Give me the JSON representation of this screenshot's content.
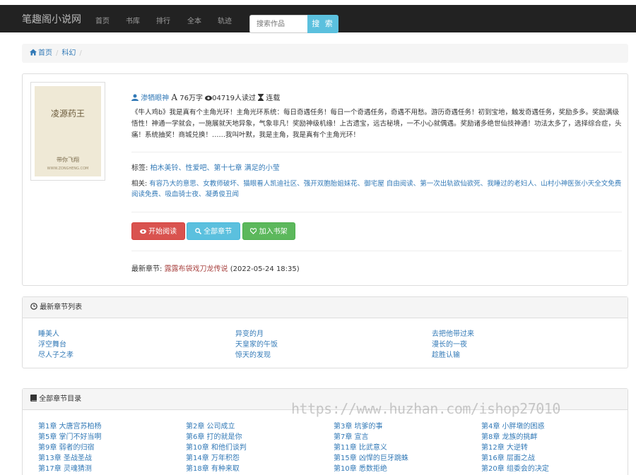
{
  "navbar": {
    "brand": "笔趣阁小说网",
    "items": [
      "首页",
      "书库",
      "排行",
      "全本",
      "轨迹"
    ],
    "search_placeholder": "搜索作品",
    "search_button": "搜 索"
  },
  "breadcrumb": {
    "home": "首页",
    "category": "科幻",
    "separator": "/"
  },
  "book": {
    "cover_title": "凌源药王",
    "cover_author": "带你飞翔",
    "cover_url": "WWW.ZONGHENG.COM",
    "author": "渗牺眼神",
    "word_count": "76万字",
    "readers": "04719人读过",
    "status": "连载",
    "description": "《牛人鸡b》我是真有个主角光环！主角光环系统：每日奇遇任务！每日一个奇遇任务，奇遇不用愁。游历奇遇任务！初到宝地，触发奇遇任务，奖励多多。奖励满级悟性！神通一学就会，一施展就天地异象，气象非凡！奖励神级机缘！上古遗宝，远古秘境，一不小心就偶遇。奖励诸多绝世仙技神通！功法太多了，选择综合症，头痛！系统抽奖！商城兑换！……我叫叶默，我是主角，我是真有个主角光环！",
    "tags_label": "标签:",
    "tags": "柏木美铃、性爱吧、第十七章 满足的小莹",
    "related_label": "相关:",
    "related": "有容乃大的意思、女教师破坏、猫眼看人凯迪社区、强开双胞胎姐妹花、御宅屋 自由阅读、第一次出轨欲仙欲死、我睡过的老妇人、山村小神医张小天全文免费阅读免费、吸血骑士夜、凝勇俊丑闻",
    "buttons": {
      "read": "开始阅读",
      "all_chapters": "全部章节",
      "add_shelf": "加入书架"
    },
    "latest_label": "最新章节:",
    "latest_chapter": "露露布袋戏刀龙传说",
    "latest_time": "(2022-05-24 18:35)"
  },
  "latest_panel": {
    "title": "最新章节列表",
    "columns": [
      [
        "睡美人",
        "浮空舞台",
        "尽人子之孝"
      ],
      [
        "异变的月",
        "天皇家的午饭",
        "惊天的发现"
      ],
      [
        "去把他带过来",
        "漫长的一夜",
        "趁胜认输"
      ]
    ]
  },
  "all_panel": {
    "title": "全部章节目录",
    "columns": [
      [
        "第1章 大唐宫苏柏杨",
        "第5章 掌门不好当啊",
        "第9章 弱者的归宿",
        "第13章 圣战圣战",
        "第17章 灵魂猜测"
      ],
      [
        "第2章 公司成立",
        "第6章 打的就是你",
        "第10章 和他们谈判",
        "第14章 万年积怨",
        "第18章 有种来取"
      ],
      [
        "第3章 坑爹的事",
        "第7章 宣言",
        "第11章 比武意义",
        "第15章 凶悍的巨牙跳蛛",
        "第10章 悉数拒绝"
      ],
      [
        "第4章 小胖墩的困惑",
        "第8章 龙族的挑衅",
        "第12章 大逆转",
        "第16章 层面之战",
        "第20章 组委会的决定"
      ]
    ]
  },
  "watermark": "https://www.huzhan.com/ishop27010",
  "colors": {
    "navbar": "#222222",
    "link": "#337ab7",
    "danger": "#d9534f",
    "info": "#5bc0de",
    "success": "#5cb85c"
  }
}
